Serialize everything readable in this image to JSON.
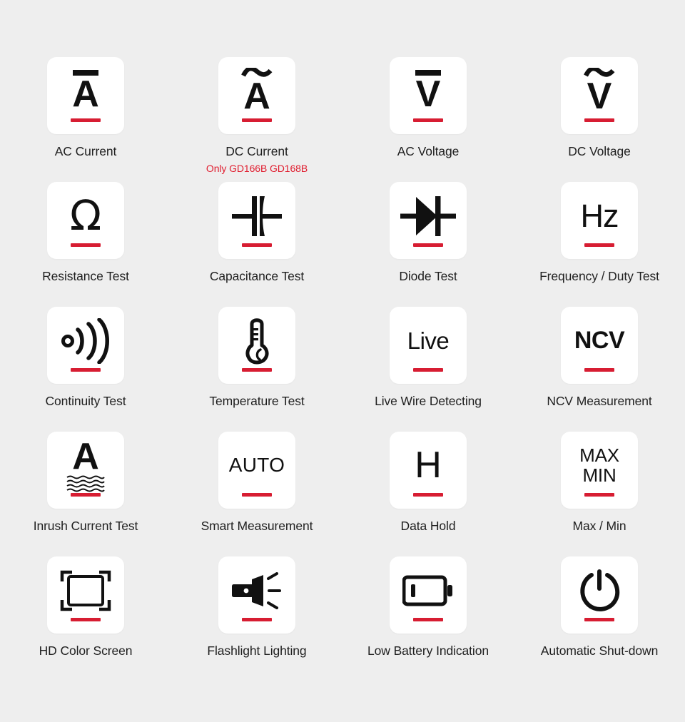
{
  "page": {
    "background_color": "#eeeeee",
    "card_color": "#ffffff",
    "accent_color": "#d71d32",
    "label_color": "#1f1f1f",
    "note_color": "#e01b2d",
    "columns": 4,
    "rows": 5
  },
  "features": [
    {
      "id": "ac-current",
      "label": "AC Current",
      "note": "",
      "icon": "a-with-bar-icon",
      "glyph_text": "A",
      "glyph_mark": "bar"
    },
    {
      "id": "dc-current",
      "label": "DC Current",
      "note": "Only GD166B GD168B",
      "icon": "a-with-tilde-icon",
      "glyph_text": "A",
      "glyph_mark": "tilde"
    },
    {
      "id": "ac-voltage",
      "label": "AC Voltage",
      "note": "",
      "icon": "v-with-bar-icon",
      "glyph_text": "V",
      "glyph_mark": "bar"
    },
    {
      "id": "dc-voltage",
      "label": "DC Voltage",
      "note": "",
      "icon": "v-with-tilde-icon",
      "glyph_text": "V",
      "glyph_mark": "tilde"
    },
    {
      "id": "resistance-test",
      "label": "Resistance Test",
      "note": "",
      "icon": "omega-icon",
      "glyph_text": "Ω",
      "glyph_mark": ""
    },
    {
      "id": "capacitance-test",
      "label": "Capacitance Test",
      "note": "",
      "icon": "capacitor-icon",
      "glyph_text": "",
      "glyph_mark": ""
    },
    {
      "id": "diode-test",
      "label": "Diode Test",
      "note": "",
      "icon": "diode-icon",
      "glyph_text": "",
      "glyph_mark": ""
    },
    {
      "id": "frequency-duty-test",
      "label": "Frequency / Duty Test",
      "note": "",
      "icon": "hz-icon",
      "glyph_text": "Hz",
      "glyph_mark": ""
    },
    {
      "id": "continuity-test",
      "label": "Continuity Test",
      "note": "",
      "icon": "buzzer-sound-waves-icon",
      "glyph_text": "",
      "glyph_mark": ""
    },
    {
      "id": "temperature-test",
      "label": "Temperature Test",
      "note": "",
      "icon": "thermometer-icon",
      "glyph_text": "",
      "glyph_mark": ""
    },
    {
      "id": "live-wire-detecting",
      "label": "Live Wire Detecting",
      "note": "",
      "icon": "live-text-icon",
      "glyph_text": "Live",
      "glyph_mark": ""
    },
    {
      "id": "ncv-measurement",
      "label": "NCV  Measurement",
      "note": "",
      "icon": "ncv-text-icon",
      "glyph_text": "NCV",
      "glyph_mark": ""
    },
    {
      "id": "inrush-current-test",
      "label": "Inrush Current Test",
      "note": "",
      "icon": "a-with-waves-icon",
      "glyph_text": "A",
      "glyph_mark": "waves"
    },
    {
      "id": "smart-measurement",
      "label": "Smart Measurement",
      "note": "",
      "icon": "auto-text-icon",
      "glyph_text": "AUTO",
      "glyph_mark": ""
    },
    {
      "id": "data-hold",
      "label": "Data Hold",
      "note": "",
      "icon": "h-text-icon",
      "glyph_text": "H",
      "glyph_mark": ""
    },
    {
      "id": "max-min",
      "label": "Max / Min",
      "note": "",
      "icon": "max-min-text-icon",
      "glyph_text": "MAX",
      "glyph_text2": "MIN",
      "glyph_mark": ""
    },
    {
      "id": "hd-color-screen",
      "label": "HD Color Screen",
      "note": "",
      "icon": "screen-frame-icon",
      "glyph_text": "",
      "glyph_mark": ""
    },
    {
      "id": "flashlight-lighting",
      "label": "Flashlight Lighting",
      "note": "",
      "icon": "flashlight-icon",
      "glyph_text": "",
      "glyph_mark": ""
    },
    {
      "id": "low-battery-indication",
      "label": "Low Battery Indication",
      "note": "",
      "icon": "low-battery-icon",
      "glyph_text": "",
      "glyph_mark": ""
    },
    {
      "id": "automatic-shut-down",
      "label": "Automatic Shut-down",
      "note": "",
      "icon": "power-icon",
      "glyph_text": "",
      "glyph_mark": ""
    }
  ]
}
